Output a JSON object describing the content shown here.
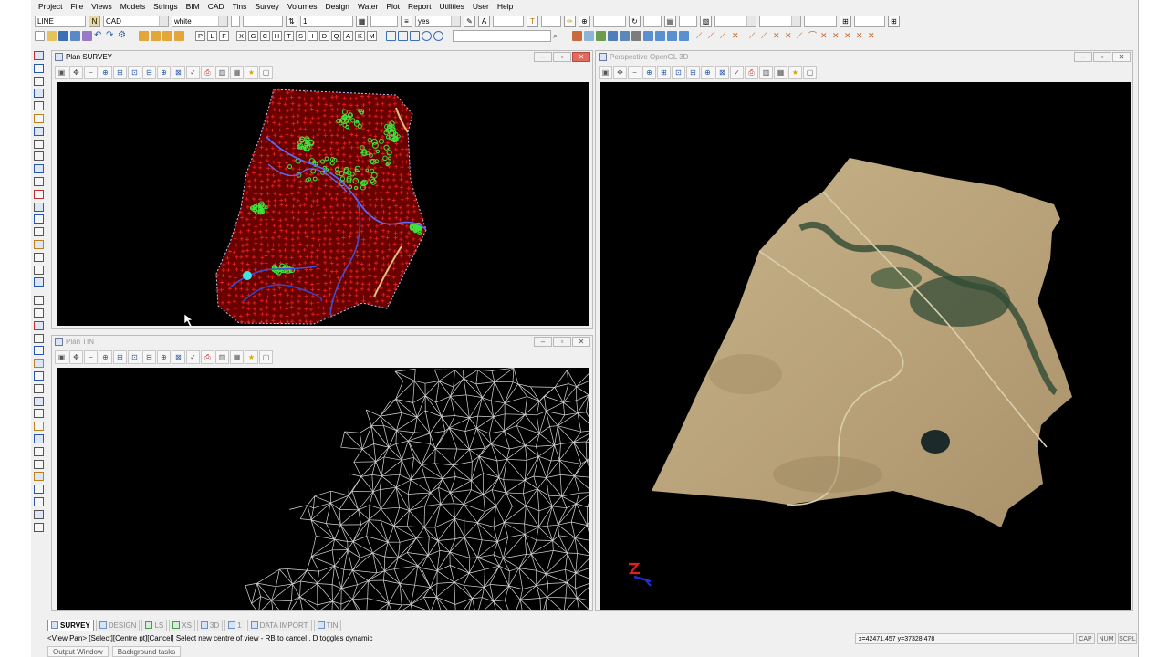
{
  "menu": [
    "Project",
    "File",
    "Views",
    "Models",
    "Strings",
    "BIM",
    "CAD",
    "Tins",
    "Survey",
    "Volumes",
    "Design",
    "Water",
    "Plot",
    "Report",
    "Utilities",
    "User",
    "Help"
  ],
  "toolbar": {
    "command_value": "LINE",
    "mode_value": "CAD",
    "colour_value": "white",
    "weight_value": "1",
    "toggle_value": "yes",
    "snap_letters": [
      "P",
      "L",
      "F",
      "X",
      "G",
      "C",
      "H",
      "T",
      "S",
      "I",
      "D",
      "Q",
      "A",
      "K",
      "M"
    ]
  },
  "windows": {
    "plan_survey": {
      "title": "Plan SURVEY"
    },
    "plan_tin": {
      "title": "Plan TIN"
    },
    "perspective": {
      "title": "Perspective OpenGL 3D"
    }
  },
  "window_tools": [
    "new",
    "pan",
    "zoom-out",
    "zoom-in",
    "zoom-box",
    "zoom-fit",
    "zoom-previous",
    "measure",
    "snap",
    "plot",
    "copy",
    "legend",
    "favourite",
    "star",
    "window"
  ],
  "tabs": [
    {
      "label": "SURVEY",
      "active": true
    },
    {
      "label": "DESIGN",
      "active": false
    },
    {
      "label": "LS",
      "active": false
    },
    {
      "label": "XS",
      "active": false
    },
    {
      "label": "3D",
      "active": false
    },
    {
      "label": "1",
      "active": false
    },
    {
      "label": "DATA IMPORT",
      "active": false
    },
    {
      "label": "TIN",
      "active": false
    }
  ],
  "status": {
    "message": "<View Pan> [Select][Centre pt][Cancel] Select new centre of view - RB to cancel , D toggles dynamic",
    "coords": "x=42471.457 y=37328.478",
    "indicators": [
      "CAP",
      "NUM",
      "SCRL"
    ]
  },
  "bottom_tabs": [
    "Output Window",
    "Background tasks"
  ],
  "colors": {
    "canvas": "#000000",
    "survey_points": "#e0201c",
    "survey_features": "#3ce63c",
    "survey_strings": "#3545c8",
    "tin_lines": "#d8d8d8",
    "terrain": "#b9a37a"
  }
}
